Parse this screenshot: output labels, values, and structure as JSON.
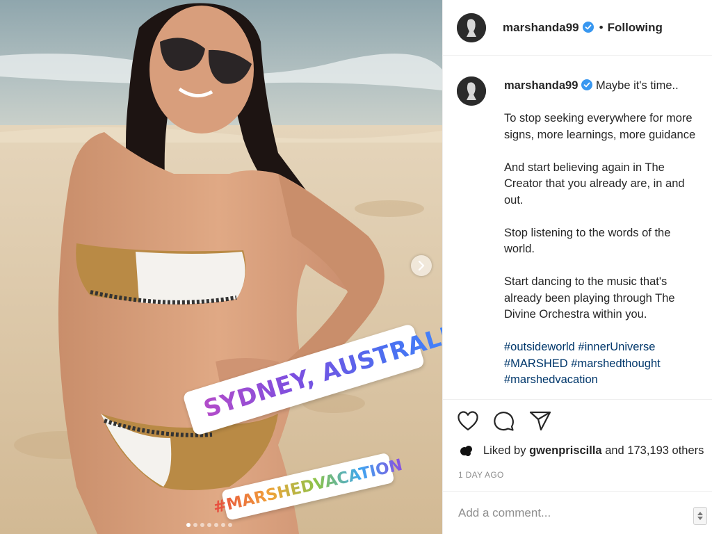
{
  "post": {
    "location_sticker": "SYDNEY, AUSTRALIA",
    "hashtag_sticker": "#MARSHEDVACATION",
    "carousel_dot_count": 7,
    "carousel_active_index": 0
  },
  "header": {
    "username": "marshanda99",
    "separator": "•",
    "follow_status": "Following"
  },
  "caption": {
    "username": "marshanda99",
    "lines": [
      "Maybe it's time..",
      "To stop seeking everywhere for more",
      "signs, more learnings, more guidance",
      "And start believing again in The",
      "Creator that you already are, in and",
      "out.",
      "Stop listening to the words of the",
      "world.",
      "Start dancing to the music that's",
      "already been playing through The",
      "Divine Orchestra within you."
    ],
    "hashtags": [
      "#outsideworld",
      "#innerUniverse",
      "#MARSHED",
      "#marshedthought",
      "#marshedvacation"
    ]
  },
  "likes": {
    "prefix": "Liked by",
    "user": "gwenpriscilla",
    "suffix": "and 173,193 others"
  },
  "time_ago": "1 DAY AGO",
  "comment": {
    "placeholder": "Add a comment..."
  },
  "icons": {
    "like": "heart-icon",
    "comment": "comment-icon",
    "share": "paper-plane-icon",
    "verified": "verified-badge-icon",
    "next": "chevron-right-icon",
    "location": "location-pin-icon"
  },
  "colors": {
    "verified_blue": "#3897f0",
    "hashtag_link": "#00376b",
    "muted_text": "#8e8e8e"
  }
}
